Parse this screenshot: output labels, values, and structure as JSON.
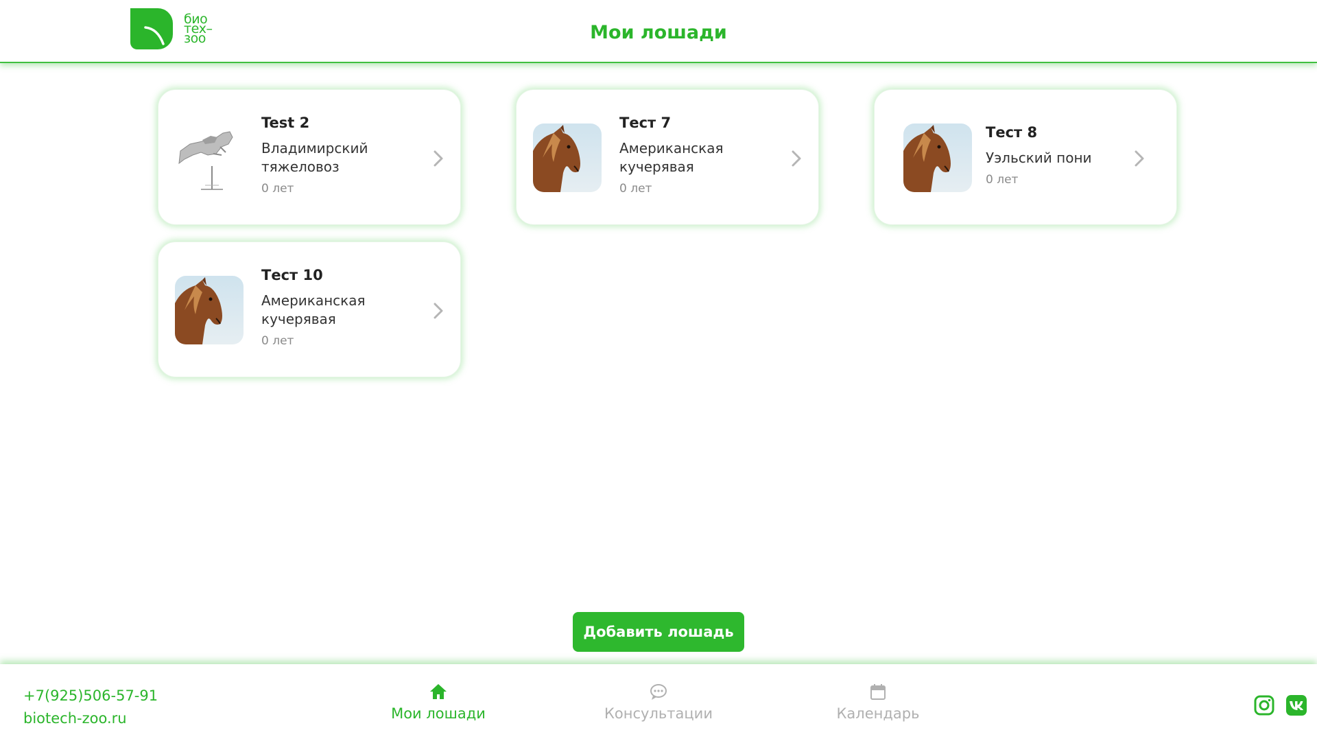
{
  "header": {
    "logo_lines": [
      "био",
      "тех–",
      "зоо"
    ],
    "title": "Мои лошади"
  },
  "horses": [
    {
      "name": "Test 2",
      "breed": "Владимирский тяжеловоз",
      "age": "0 лет",
      "image": "jumping-horse-illustration"
    },
    {
      "name": "Тест 7",
      "breed": "Американская кучерявая",
      "age": "0 лет",
      "image": "horse-photo"
    },
    {
      "name": "Тест 8",
      "breed": "Уэльский пони",
      "age": "0 лет",
      "image": "horse-photo"
    },
    {
      "name": "Тест 10",
      "breed": "Американская кучерявая",
      "age": "0 лет",
      "image": "horse-photo"
    }
  ],
  "add_button": "Добавить лошадь",
  "footer": {
    "phone": "+7(925)506-57-91",
    "site": "biotech-zoo.ru",
    "nav": [
      {
        "label": "Мои лошади",
        "icon": "home-icon",
        "active": true
      },
      {
        "label": "Консультации",
        "icon": "chat-icon",
        "active": false
      },
      {
        "label": "Календарь",
        "icon": "calendar-icon",
        "active": false
      }
    ],
    "social": [
      "instagram-icon",
      "vk-icon"
    ]
  },
  "colors": {
    "accent": "#2bb52b",
    "inactive": "#b0b0b0"
  }
}
